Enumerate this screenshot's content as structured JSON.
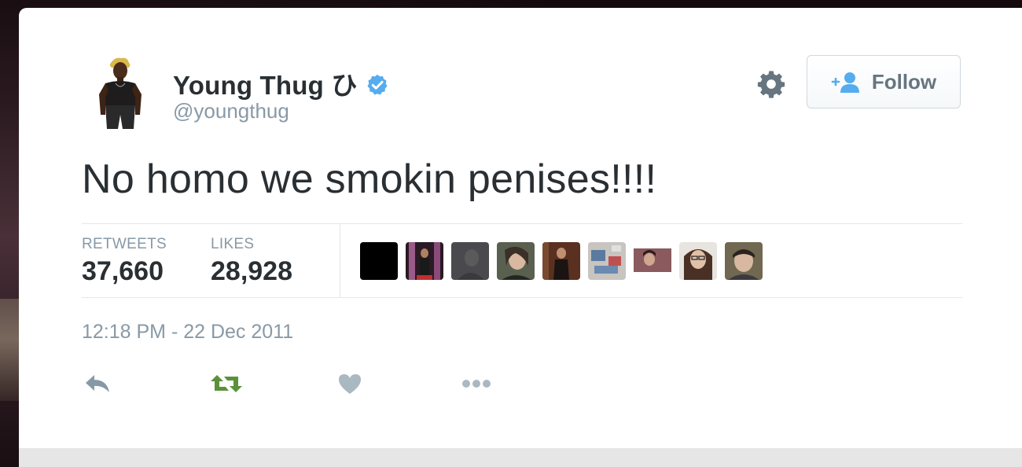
{
  "user": {
    "display_name": "Young Thug ひ",
    "handle": "@youngthug",
    "verified": true
  },
  "follow_button": {
    "label": "Follow"
  },
  "tweet": {
    "text": "No homo we smokin penises!!!!",
    "timestamp": "12:18 PM - 22 Dec 2011"
  },
  "stats": {
    "retweets_label": "RETWEETS",
    "retweets_value": "37,660",
    "likes_label": "LIKES",
    "likes_value": "28,928"
  },
  "likers_count_shown": 9,
  "colors": {
    "verified_blue": "#55acee",
    "retweet_green": "#5c913b",
    "icon_gray": "#8899a6",
    "text_dark": "#292f33"
  },
  "icons": {
    "verified": "verified-badge-icon",
    "settings": "gear-icon",
    "follow": "add-person-icon",
    "reply": "reply-icon",
    "retweet": "retweet-icon",
    "like": "heart-icon",
    "more": "more-dots-icon"
  }
}
